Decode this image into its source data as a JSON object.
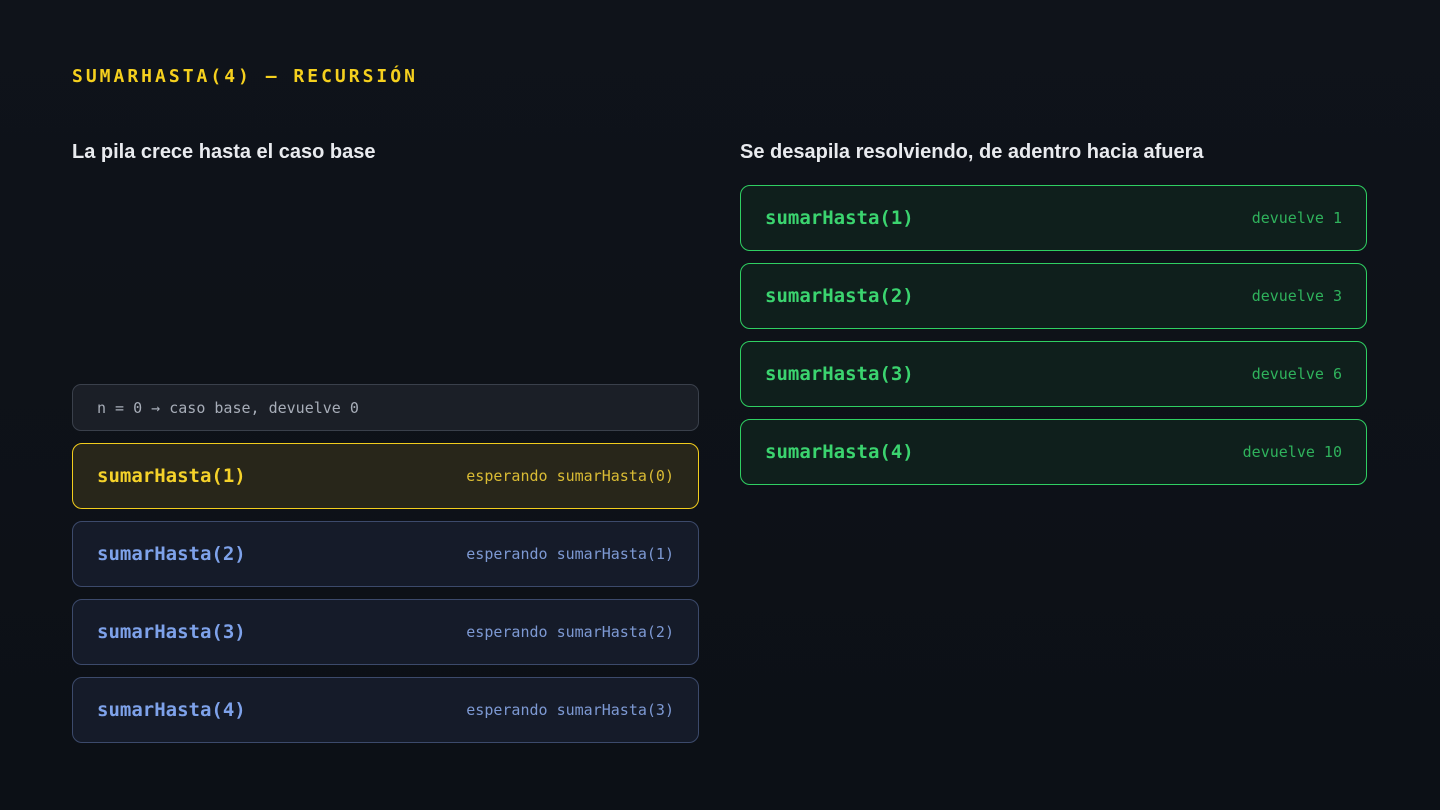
{
  "title": "SUMARHASTA(4) — RECURSIÓN",
  "colors": {
    "accent_yellow": "#f5d01e",
    "waiting_blue": "#7ea2ea",
    "resolved_green": "#3bd46f",
    "background": "#0f131a"
  },
  "left": {
    "heading": "La pila crece hasta el caso base",
    "base_case": "n = 0 → caso base, devuelve 0",
    "frames": [
      {
        "call": "sumarHasta(1)",
        "status": "esperando sumarHasta(0)"
      },
      {
        "call": "sumarHasta(2)",
        "status": "esperando sumarHasta(1)"
      },
      {
        "call": "sumarHasta(3)",
        "status": "esperando sumarHasta(2)"
      },
      {
        "call": "sumarHasta(4)",
        "status": "esperando sumarHasta(3)"
      }
    ]
  },
  "right": {
    "heading": "Se desapila resolviendo, de adentro hacia afuera",
    "frames": [
      {
        "call": "sumarHasta(1)",
        "result": "devuelve 1"
      },
      {
        "call": "sumarHasta(2)",
        "result": "devuelve 3"
      },
      {
        "call": "sumarHasta(3)",
        "result": "devuelve 6"
      },
      {
        "call": "sumarHasta(4)",
        "result": "devuelve 10"
      }
    ]
  }
}
